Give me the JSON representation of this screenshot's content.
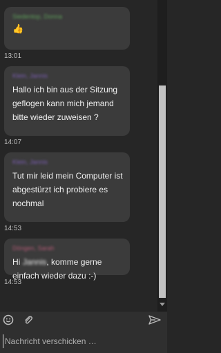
{
  "messages": [
    {
      "sender": "Siedentop, Donna",
      "sender_color": "#5e9e5a",
      "text": "👍",
      "time": "13:01"
    },
    {
      "sender": "Klein, Jannis",
      "sender_color": "#7a5db0",
      "text": "Hallo ich bin aus der Sitzung geflogen kann mich jemand bitte wieder zuweisen ?",
      "time": "14:07"
    },
    {
      "sender": "Klein, Jannis",
      "sender_color": "#7a5db0",
      "text": "Tut mir leid mein Computer ist abgestürzt ich probiere es nochmal",
      "time": "14:53"
    },
    {
      "sender": "Döngen, Sarah",
      "sender_color": "#b05a74",
      "greeting": "Hi",
      "mention": "Jannis",
      "text": ", komme gerne einfach wieder dazu :-)",
      "time": "14:53"
    }
  ],
  "toolbar": {
    "emoji_icon": "smiley-icon",
    "attach_icon": "paperclip-icon",
    "send_icon": "send-icon"
  },
  "composer": {
    "placeholder": "Nachricht verschicken …"
  }
}
